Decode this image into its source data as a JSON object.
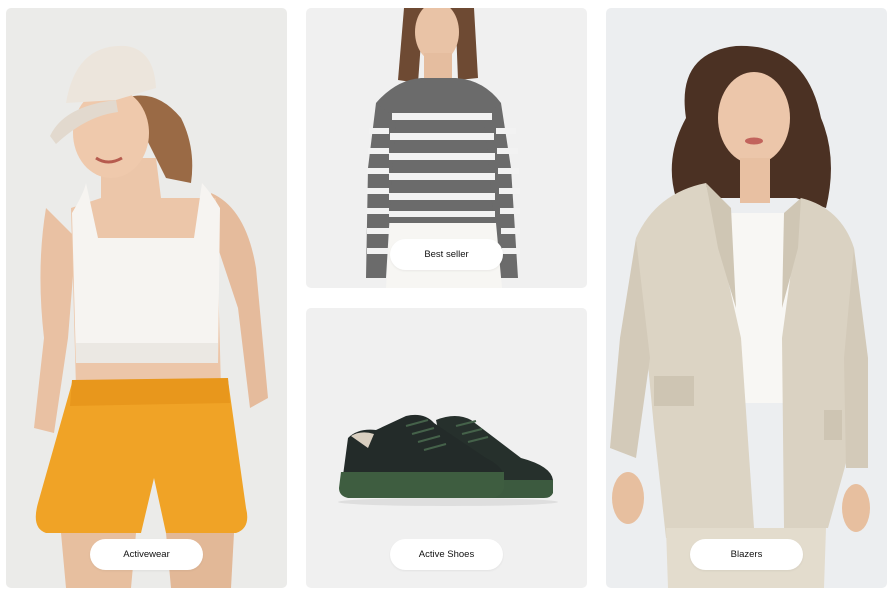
{
  "categories": [
    {
      "label": "Activewear",
      "image": "woman-in-white-cap-crop-top-and-orange-shorts"
    },
    {
      "label": "Best seller",
      "image": "woman-in-grey-white-striped-long-sleeve-top"
    },
    {
      "label": "Active Shoes",
      "image": "dark-green-canvas-sneakers"
    },
    {
      "label": "Blazers",
      "image": "woman-in-beige-linen-blazer"
    }
  ],
  "colors": {
    "tile_bg_left": "#ebebe9",
    "tile_bg_center": "#f0f0f0",
    "tile_bg_right": "#eceef0",
    "pill_bg": "#ffffff",
    "pill_text": "#111111"
  }
}
